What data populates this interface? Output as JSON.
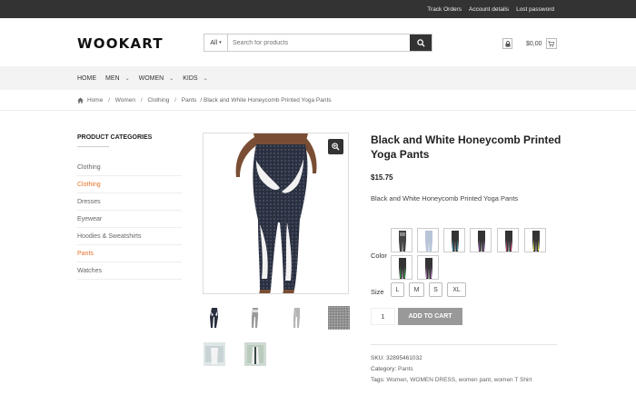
{
  "topbar": {
    "links": [
      "Track Orders",
      "Account details",
      "Lost password"
    ]
  },
  "header": {
    "logo": "WOOKART",
    "search": {
      "category": "All",
      "placeholder": "Search for products"
    },
    "cart_total": "$0,00"
  },
  "nav": {
    "items": [
      "HOME",
      "MEN",
      "WOMEN",
      "KIDS"
    ]
  },
  "breadcrumb": [
    "Home",
    "Women",
    "Clothing",
    "Pants",
    "/ Black and White Honeycomb Printed Yoga Pants"
  ],
  "sidebar": {
    "heading": "PRODUCT CATEGORIES",
    "items": [
      "Clothing",
      "Clothing",
      "Dresses",
      "Eyewear",
      "Hoodies & Sweatshirts",
      "Pants",
      "Watches"
    ]
  },
  "product": {
    "title": "Black and White Honeycomb Printed Yoga Pants",
    "price": "$15.75",
    "short_description": "Black and White Honeycomb Printed Yoga Pants",
    "color_label": "Color",
    "size_label": "Size",
    "sizes": [
      "L",
      "M",
      "S",
      "XL"
    ],
    "quantity": "1",
    "add_to_cart": "ADD TO CART",
    "sku_label": "SKU:",
    "sku": "32895461032",
    "category_label": "Category:",
    "category": "Pants",
    "tags_label": "Tags:",
    "tags": "Women, WOMEN DRESS, women pant, women T Shirt"
  },
  "colors": {
    "accent": "#e8702a",
    "dark": "#333333",
    "button": "#999999"
  },
  "icons": {
    "search": "search-icon",
    "zoom": "zoom-icon",
    "lock": "lock-icon",
    "cart": "cart-icon",
    "home": "home-icon"
  }
}
